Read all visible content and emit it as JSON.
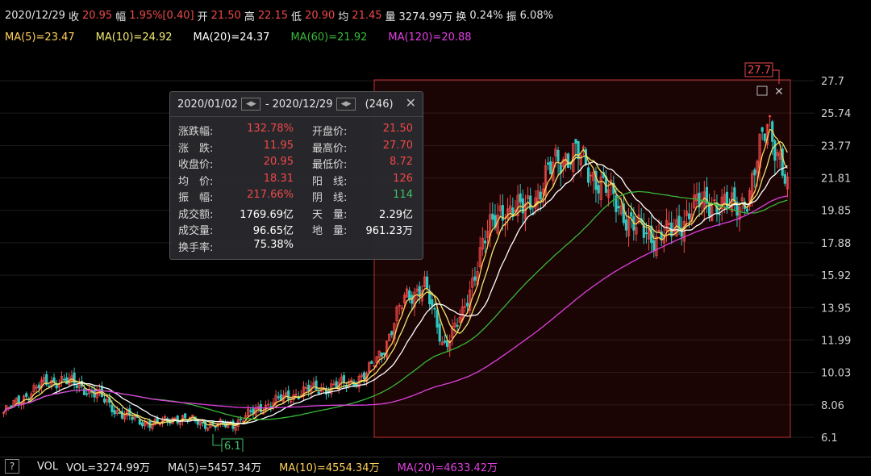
{
  "info": {
    "date": "2020/12/29",
    "close_label": "收",
    "close": "20.95",
    "chg_label": "幅",
    "chg": "1.95%[0.40]",
    "open_label": "开",
    "open": "21.50",
    "high_label": "高",
    "high": "22.15",
    "low_label": "低",
    "low": "20.90",
    "avg_label": "均",
    "avg": "21.45",
    "vol_label": "量",
    "vol": "3274.99万",
    "turn_label": "换",
    "turn": "0.24%",
    "amp_label": "振",
    "amp": "6.08%"
  },
  "ma": {
    "ma5": "MA(5)=23.47",
    "ma10": "MA(10)=24.92",
    "ma20": "MA(20)=24.37",
    "ma60": "MA(60)=21.92",
    "ma120": "MA(120)=20.88"
  },
  "volume": {
    "help": "?",
    "label": "VOL",
    "vol": "VOL=3274.99万",
    "ma5": "MA(5)=5457.34万",
    "ma10": "MA(10)=4554.34万",
    "ma20": "MA(20)=4633.42万"
  },
  "tooltip": {
    "range_start": "2020/01/02",
    "dash": "-",
    "range_end": "2020/12/29",
    "count": "(246)",
    "close": "✕",
    "rows": [
      {
        "k1": "涨跌幅:",
        "v1": "132.78%",
        "c1": "#f04848",
        "k2": "开盘价:",
        "v2": "21.50",
        "c2": "#f04848"
      },
      {
        "k1": "涨　跌:",
        "v1": "11.95",
        "c1": "#f04848",
        "k2": "最高价:",
        "v2": "27.70",
        "c2": "#f04848"
      },
      {
        "k1": "收盘价:",
        "v1": "20.95",
        "c1": "#f04848",
        "k2": "最低价:",
        "v2": "8.72",
        "c2": "#f04848"
      },
      {
        "k1": "均　价:",
        "v1": "18.31",
        "c1": "#f04848",
        "k2": "阳　线:",
        "v2": "126",
        "c2": "#f04848"
      },
      {
        "k1": "振　幅:",
        "v1": "217.66%",
        "c1": "#f04848",
        "k2": "阴　线:",
        "v2": "114",
        "c2": "#40c068"
      },
      {
        "k1": "成交额:",
        "v1": "1769.69亿",
        "c1": "#ffffff",
        "k2": "天　量:",
        "v2": "2.29亿",
        "c2": "#ffffff"
      },
      {
        "k1": "成交量:",
        "v1": "96.65亿",
        "c1": "#ffffff",
        "k2": "地　量:",
        "v2": "961.23万",
        "c2": "#ffffff"
      },
      {
        "k1": "换手率:",
        "v1": "75.38%",
        "c1": "#ffffff",
        "k2": "",
        "v2": "",
        "c2": "#ffffff"
      }
    ]
  },
  "chart_data": {
    "type": "candlestick",
    "y_ticks": [
      "27.7",
      "25.74",
      "23.77",
      "21.81",
      "19.85",
      "17.88",
      "15.92",
      "13.95",
      "11.99",
      "10.03",
      "8.06",
      "6.1"
    ],
    "ylim": [
      6.1,
      27.7
    ],
    "annotations": {
      "high_label": "27.7",
      "low_label": "6.1"
    },
    "close_series": [
      7.6,
      8.5,
      9.3,
      9.6,
      9.2,
      8.6,
      7.6,
      7.1,
      6.9,
      7.3,
      7.1,
      6.8,
      6.9,
      7.6,
      8.2,
      8.6,
      9.0,
      9.1,
      9.4,
      9.9,
      11.8,
      14.6,
      15.3,
      11.7,
      13.4,
      17.7,
      19.9,
      19.8,
      20.9,
      23.1,
      23.2,
      21.8,
      20.4,
      18.8,
      18.3,
      18.5,
      20.0,
      20.4,
      20.0,
      20.7,
      25.6,
      20.95
    ],
    "ma_series": [
      {
        "name": "MA(20)",
        "color": "#ffffff"
      },
      {
        "name": "MA(60)",
        "color": "#38b838"
      },
      {
        "name": "MA(120)",
        "color": "#e040e0"
      }
    ],
    "colors": {
      "up": "#f04848",
      "down": "#2ec8c0",
      "ma5": "#ffd05a",
      "ma10": "#f0e870",
      "ma20": "#ffffff",
      "ma60": "#38b838",
      "ma120": "#e040e0",
      "grid": "#1d1d1d"
    }
  }
}
